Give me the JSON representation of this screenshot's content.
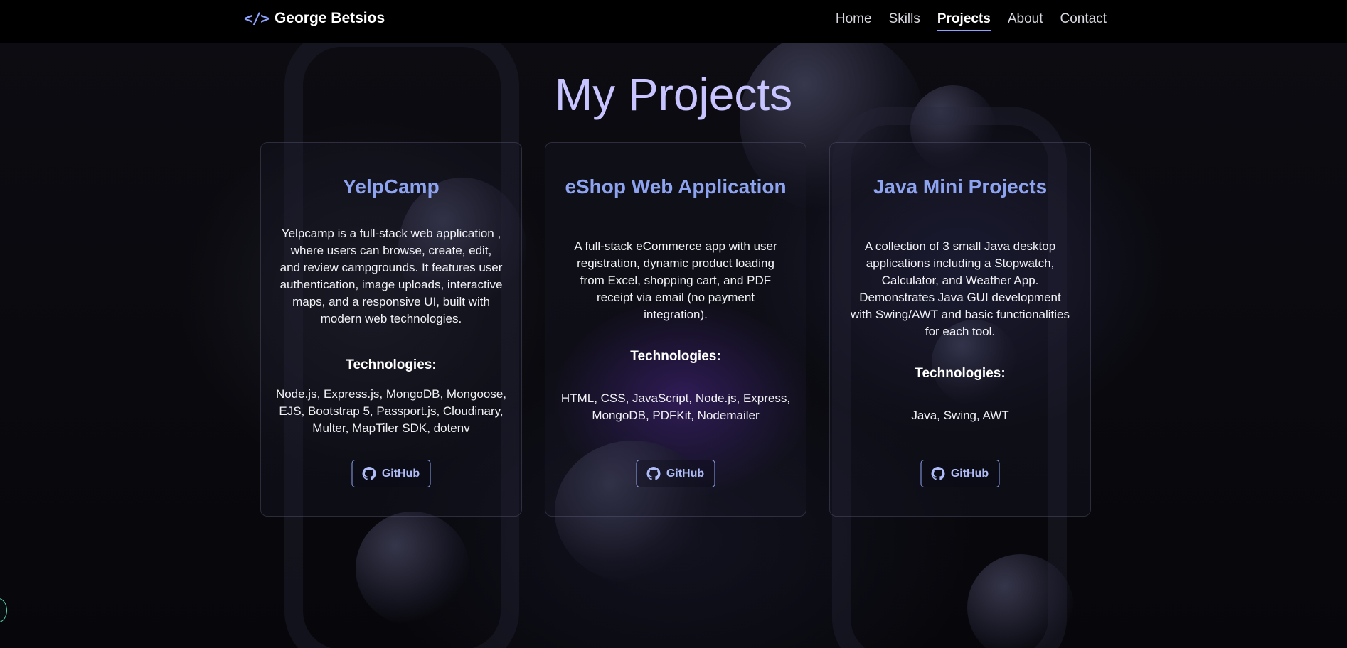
{
  "header": {
    "brand_icon": "</>",
    "brand_name": "George Betsios",
    "nav": [
      {
        "label": "Home",
        "active": false
      },
      {
        "label": "Skills",
        "active": false
      },
      {
        "label": "Projects",
        "active": true
      },
      {
        "label": "About",
        "active": false
      },
      {
        "label": "Contact",
        "active": false
      }
    ]
  },
  "main": {
    "title": "My Projects",
    "projects": [
      {
        "title": "YelpCamp",
        "description": "Yelpcamp is a full-stack web application , where users can browse, create, edit, and review campgrounds. It features user authentication, image uploads, interactive maps, and a responsive UI, built with modern web technologies.",
        "tech_label": "Technologies:",
        "technologies": "Node.js, Express.js, MongoDB, Mongoose, EJS, Bootstrap 5, Passport.js, Cloudinary, Multer, MapTiler SDK, dotenv",
        "button_label": "GitHub",
        "button_icon": "github-icon"
      },
      {
        "title": "eShop Web Application",
        "description": "A full-stack eCommerce app with user registration, dynamic product loading from Excel, shopping cart, and PDF receipt via email (no payment integration).",
        "tech_label": "Technologies:",
        "technologies": "HTML, CSS, JavaScript, Node.js, Express, MongoDB, PDFKit, Nodemailer",
        "button_label": "GitHub",
        "button_icon": "github-icon"
      },
      {
        "title": "Java Mini Projects",
        "description": "A collection of 3 small Java desktop applications including a Stopwatch, Calculator, and Weather App. Demonstrates Java GUI development with Swing/AWT and basic functionalities for each tool.",
        "tech_label": "Technologies:",
        "technologies": "Java, Swing, AWT",
        "button_label": "GitHub",
        "button_icon": "github-icon"
      }
    ]
  },
  "colors": {
    "accent": "#8ea3f0",
    "title": "#c8c4ff",
    "header_bg": "#000000"
  }
}
